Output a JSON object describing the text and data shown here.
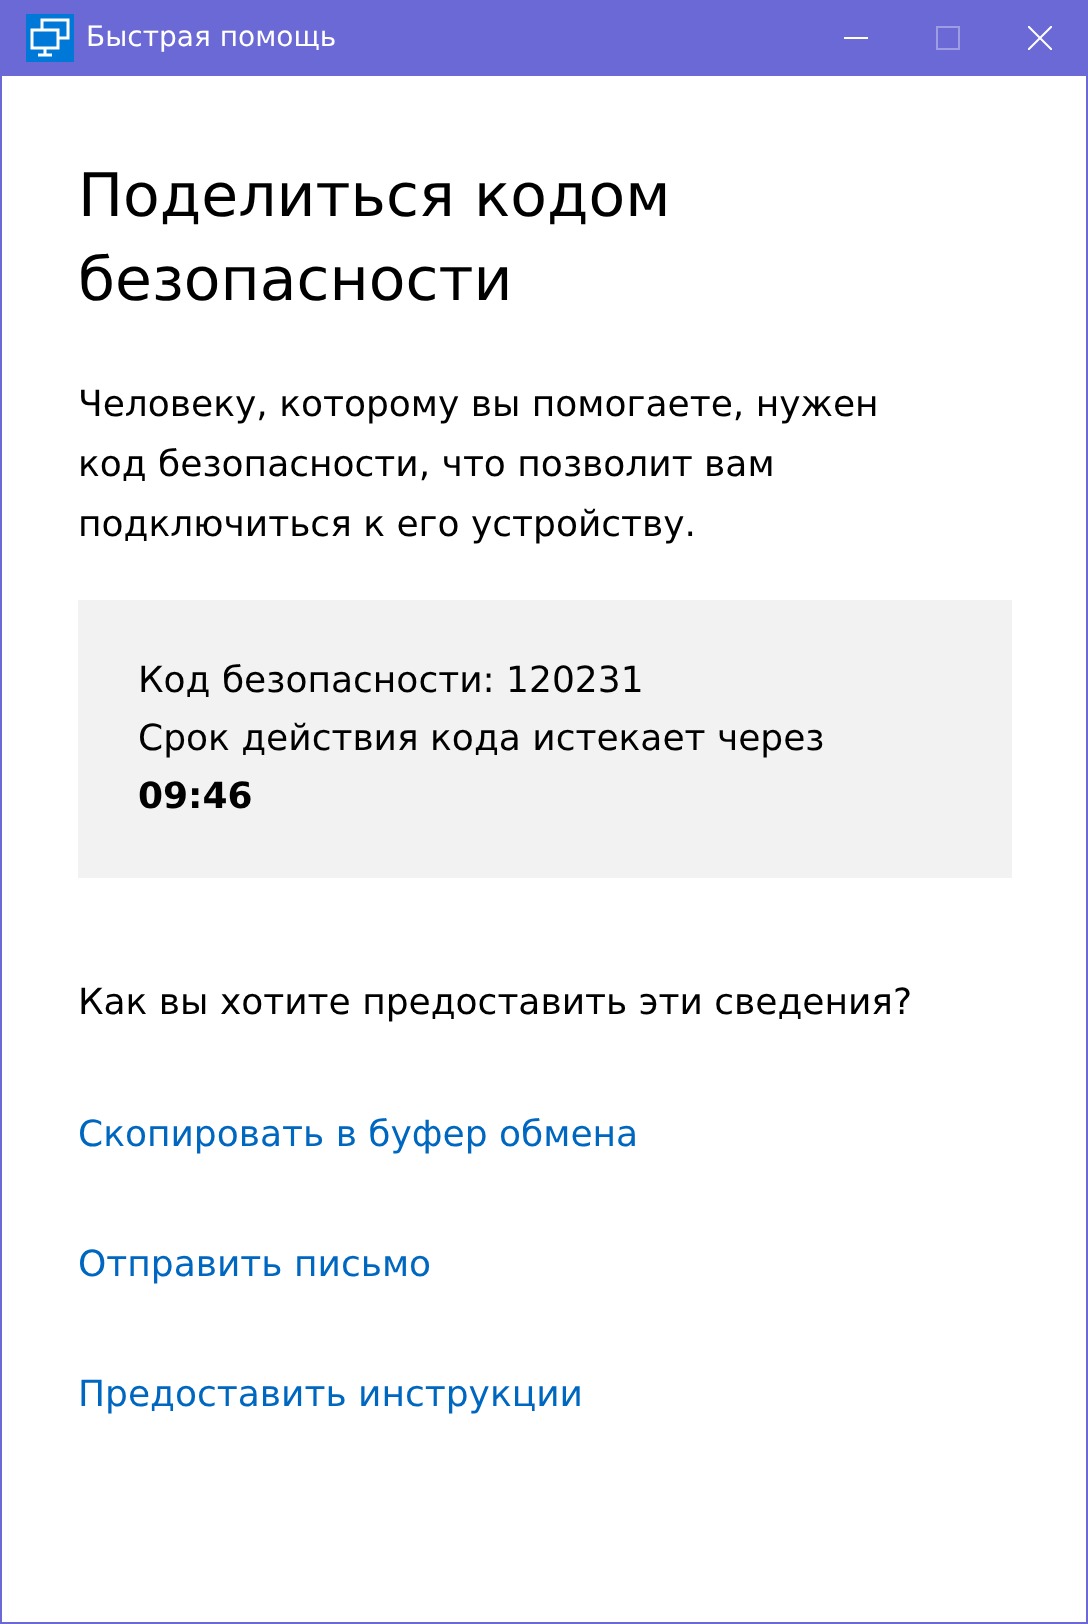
{
  "window": {
    "title": "Быстрая помощь",
    "controls": [
      {
        "kind": "minimize",
        "disabled": false
      },
      {
        "kind": "maximize",
        "disabled": true
      },
      {
        "kind": "close",
        "disabled": false
      }
    ]
  },
  "heading": "Поделиться кодом безопасности",
  "description": "Человеку, которому вы помогаете, нужен код безопасности, что позволит вам подключиться к его устройству.",
  "code_box": {
    "code_line": "Код безопасности: 120231",
    "expiry_line": "Срок действия кода истекает через **09:46**"
  },
  "question": "Как вы хотите предоставить эти сведения?",
  "links": [
    "Скопировать в буфер обмена",
    "Отправить письмо",
    "Предоставить инструкции"
  ]
}
